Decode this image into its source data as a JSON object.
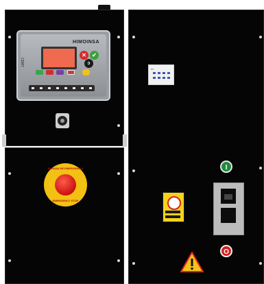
{
  "controller": {
    "brand": "HIMOINSA",
    "model_label": "CEM7",
    "buttons": {
      "stop_symbol": "✕",
      "start_symbol": "✔",
      "confirm_symbol": "ᴐ",
      "mode_colors": [
        "#35a74a",
        "#d42c2c",
        "#7a3fa0",
        "#c73c3c"
      ]
    }
  },
  "emergency_stop": {
    "text_top": "PARADA DE EMERGENCIA",
    "text_bottom": "EMERGENCY STOP"
  },
  "indicators": {
    "on_symbol": "I",
    "off_symbol": "O",
    "on_color": "#1f8a3c",
    "off_color": "#d32020"
  },
  "icons": {
    "warning": "warning-triangle-icon",
    "prohibition": "no-access-sign-icon",
    "key": "key-switch-icon"
  }
}
